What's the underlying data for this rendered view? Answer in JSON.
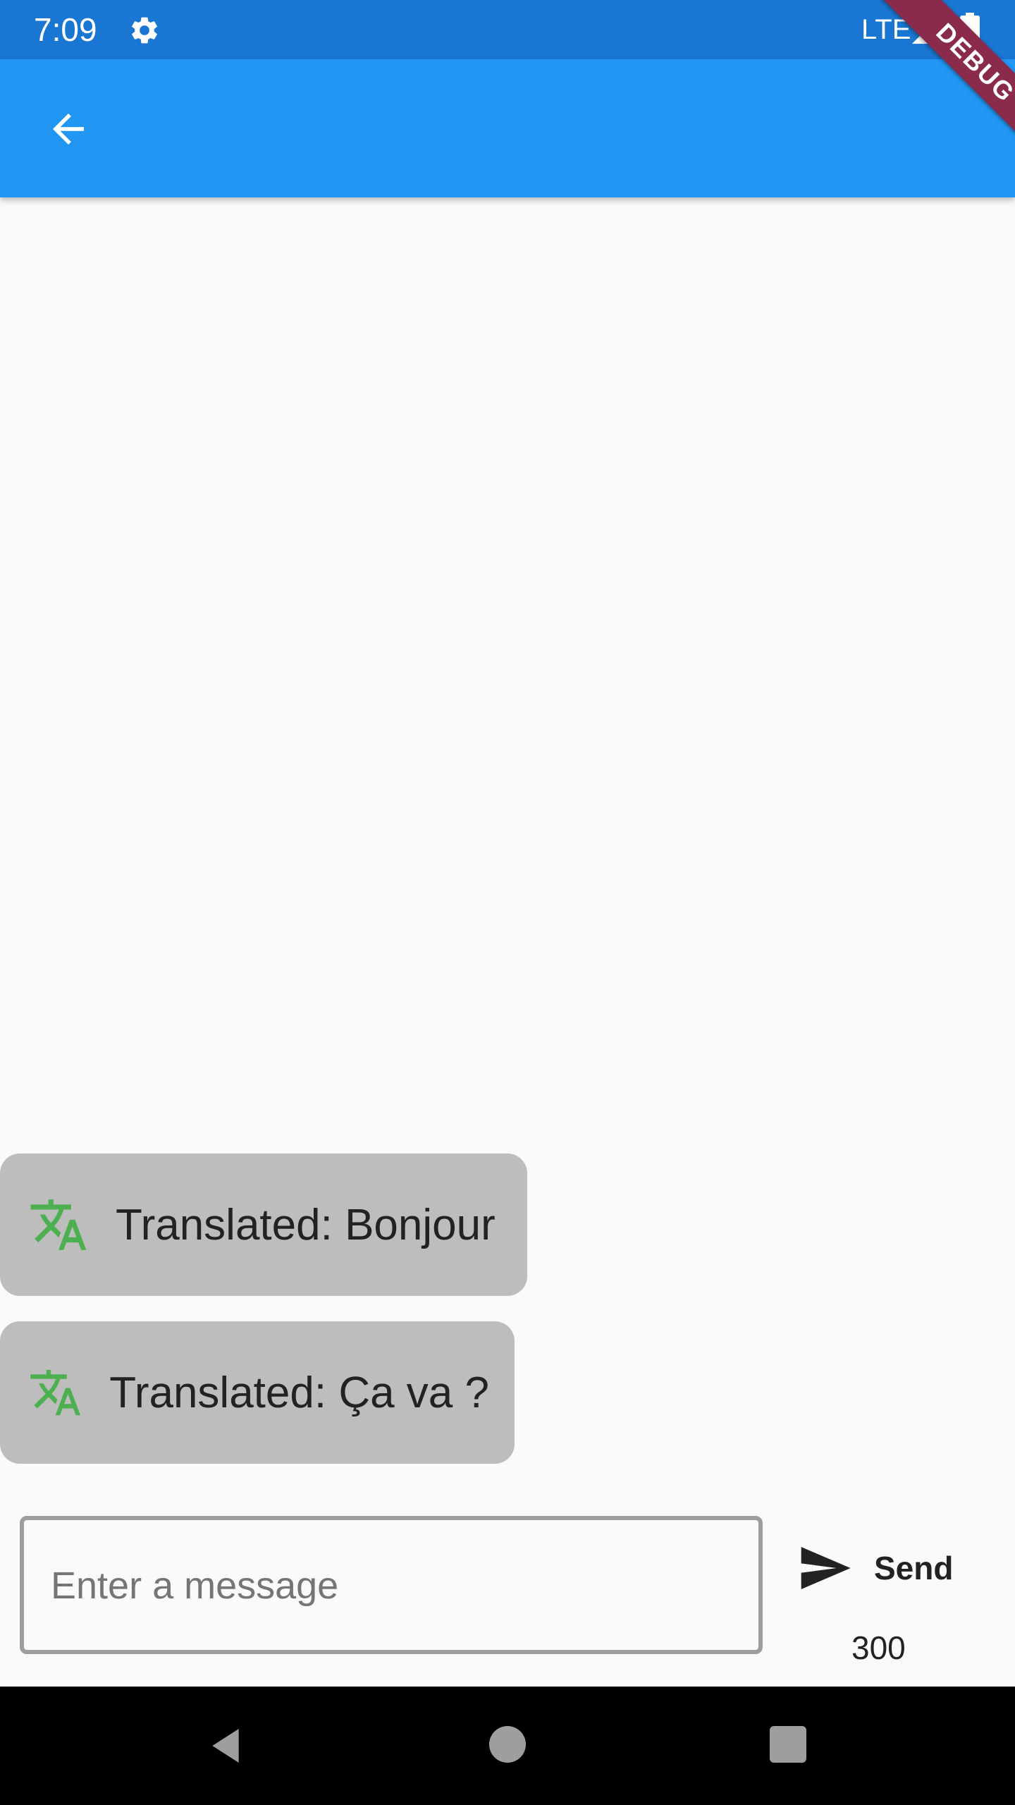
{
  "status_bar": {
    "time": "7:09",
    "network": "LTE",
    "icons": [
      "settings-icon",
      "signal-icon",
      "battery-icon"
    ]
  },
  "app_bar": {
    "icon": "arrow-back-icon",
    "color": "#2196f3"
  },
  "debug_banner": "DEBUG",
  "messages": [
    {
      "icon": "translate-icon",
      "text": "Translated: Bonjour"
    },
    {
      "icon": "translate-icon",
      "text": "Translated: Ça va ?"
    }
  ],
  "composer": {
    "placeholder": "Enter a message",
    "value": "",
    "send_label": "Send",
    "send_icon": "send-icon",
    "char_count": "300"
  },
  "nav_bar": {
    "icons": [
      "nav-back-icon",
      "nav-home-icon",
      "nav-recents-icon"
    ]
  },
  "colors": {
    "status_bar": "#1976d2",
    "app_bar": "#2196f3",
    "bubble": "#bdbdbd",
    "translate_icon": "#4caf50",
    "debug_ribbon": "#8a2a4c"
  }
}
